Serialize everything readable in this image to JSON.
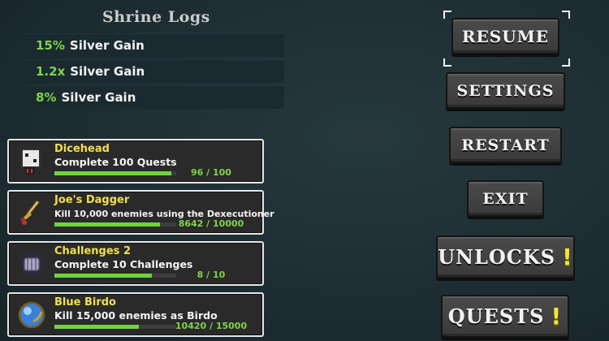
{
  "shrine": {
    "title": "Shrine Logs",
    "logs": [
      {
        "value": "15%",
        "label": "Silver Gain"
      },
      {
        "value": "1.2x",
        "label": "Silver Gain"
      },
      {
        "value": "8%",
        "label": "Silver Gain"
      }
    ]
  },
  "quests": [
    {
      "name": "Dicehead",
      "desc": "Complete 100 Quests",
      "count": "96 / 100",
      "progress": 0.96,
      "icon": "dice-icon"
    },
    {
      "name": "Joe's Dagger",
      "desc": "Kill 10,000 enemies using the Dexecutioner",
      "count": "8642 / 10000",
      "progress": 0.8642,
      "icon": "dagger-icon"
    },
    {
      "name": "Challenges 2",
      "desc": "Complete 10 Challenges",
      "count": "8 / 10",
      "progress": 0.8,
      "icon": "gauntlet-icon"
    },
    {
      "name": "Blue Birdo",
      "desc": "Kill 15,000 enemies as Birdo",
      "count": "10420 / 15000",
      "progress": 0.6947,
      "icon": "blue-orb-icon"
    }
  ],
  "menu": {
    "resume": "RESUME",
    "settings": "SETTINGS",
    "restart": "RESTART",
    "exit": "EXIT",
    "unlocks": "UNLOCKS",
    "quests": "QUESTS",
    "alert": "!"
  },
  "colors": {
    "accent_green": "#7fd44a",
    "name_yellow": "#f1e04a",
    "alert_yellow": "#f4e63a"
  }
}
